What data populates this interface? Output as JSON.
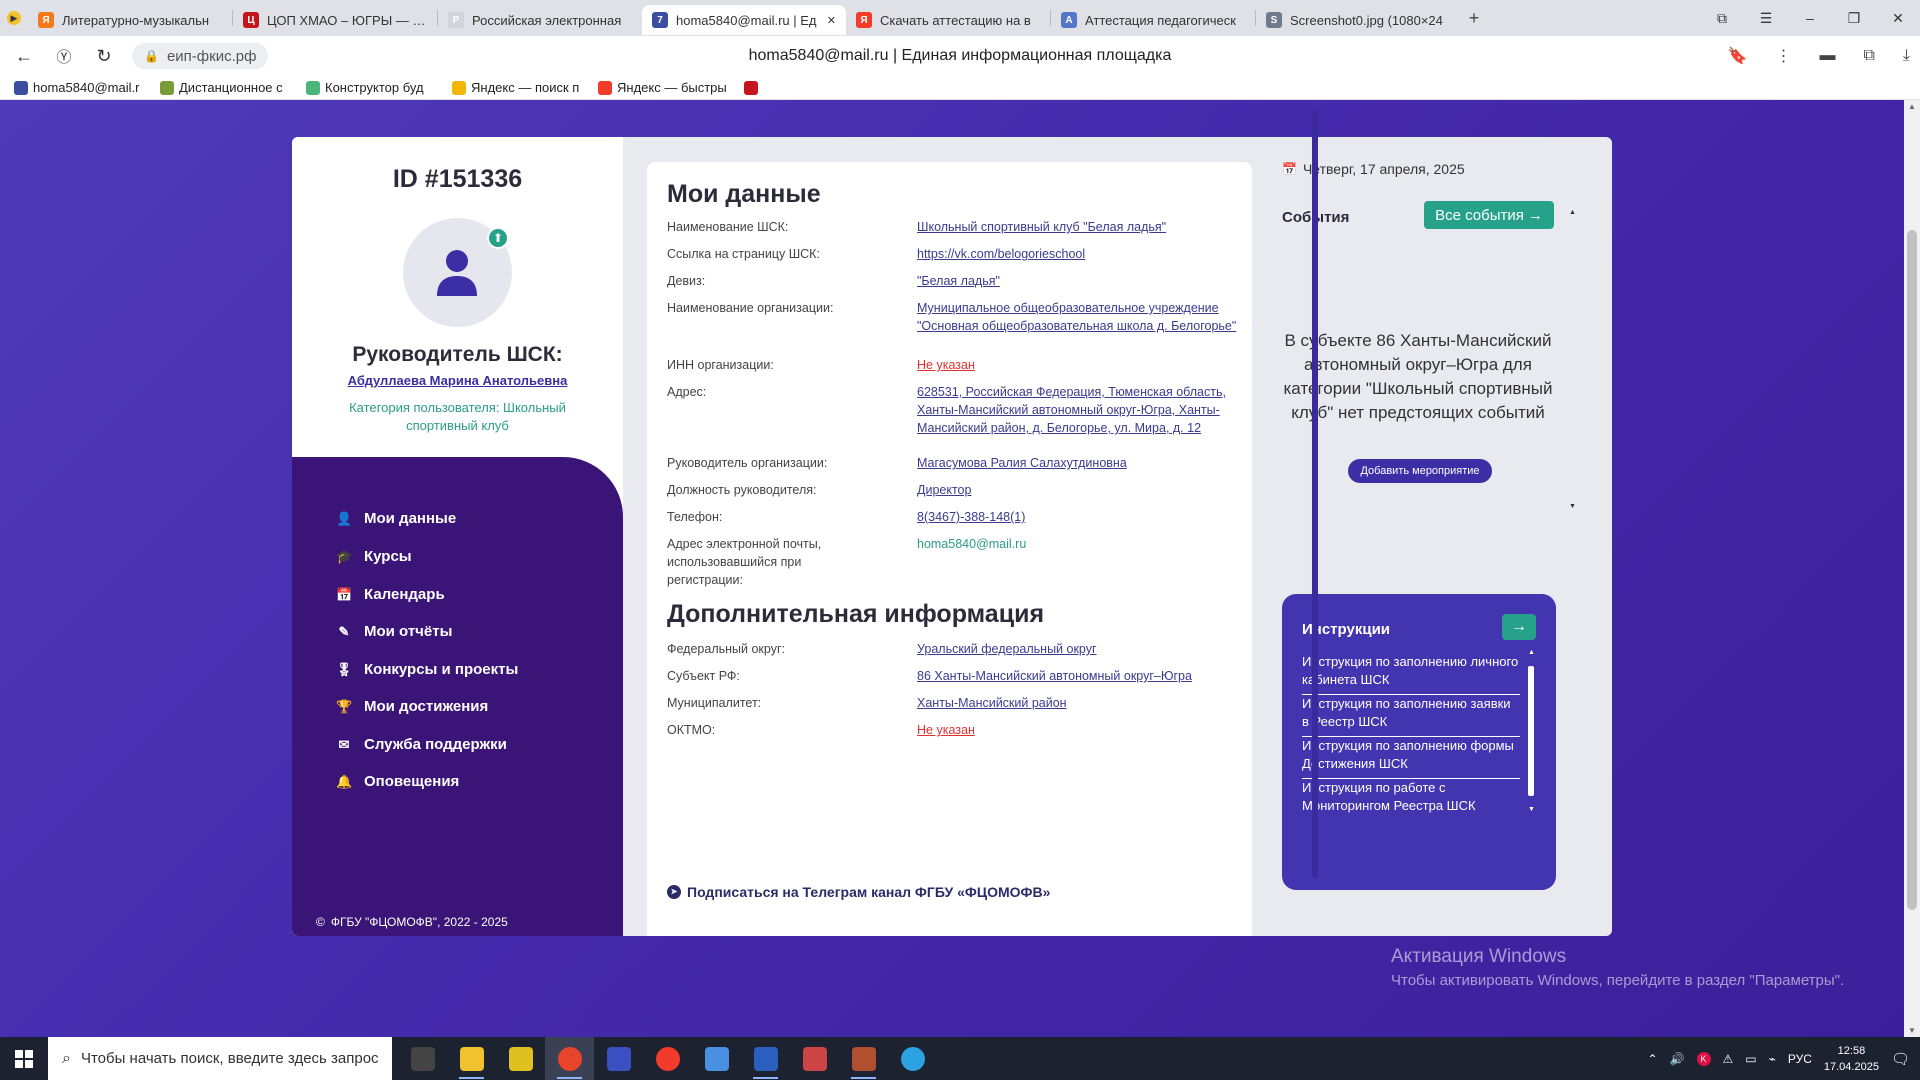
{
  "browser": {
    "tabs": [
      {
        "title": "Литературно-музыкальн",
        "favicon_color": "#f27a1a",
        "favicon_glyph": "Я"
      },
      {
        "title": "ЦОП ХМАО – ЮГРЫ — Эл",
        "favicon_color": "#c4161c",
        "favicon_glyph": "Ц"
      },
      {
        "title": "Российская электронная",
        "favicon_color": "#d0d4dc",
        "favicon_glyph": "Р"
      },
      {
        "title": "homa5840@mail.ru | Ед",
        "favicon_color": "#3b4fa0",
        "favicon_glyph": "7",
        "active": true
      },
      {
        "title": "Скачать аттестацию на в",
        "favicon_color": "#f23b2b",
        "favicon_glyph": "Я"
      },
      {
        "title": "Аттестация педагогическ",
        "favicon_color": "#5477c9",
        "favicon_glyph": "А"
      },
      {
        "title": "Screenshot0.jpg (1080×24",
        "favicon_color": "#6f7b8c",
        "favicon_glyph": "S"
      }
    ],
    "url": "еип-фкис.рф",
    "page_title": "homa5840@mail.ru | Единая информационная площадка",
    "bookmarks": [
      {
        "label": "homa5840@mail.r",
        "favicon_color": "#3b4fa0"
      },
      {
        "label": "Дистанционное с",
        "favicon_color": "#7a9a3a"
      },
      {
        "label": "Конструктор буд",
        "favicon_color": "#4bb57a"
      },
      {
        "label": "Яндекс — поиск п",
        "favicon_color": "#f2b705"
      },
      {
        "label": "Яндекс — быстры",
        "favicon_color": "#f23b2b"
      },
      {
        "label": "",
        "favicon_color": "#c4161c"
      }
    ]
  },
  "profile": {
    "id_title": "ID #151336",
    "role": "Руководитель ШСК:",
    "name": "Абдуллаева Марина Анатольевна",
    "category": "Категория пользователя: Школьный спортивный клуб"
  },
  "nav": [
    {
      "label": "Мои данные",
      "icon": "user-icon",
      "glyph": "👤"
    },
    {
      "label": "Курсы",
      "icon": "graduation-cap-icon",
      "glyph": "🎓"
    },
    {
      "label": "Календарь",
      "icon": "calendar-icon",
      "glyph": "📅"
    },
    {
      "label": "Мои отчёты",
      "icon": "edit-icon",
      "glyph": "✎"
    },
    {
      "label": "Конкурсы и проекты",
      "icon": "medal-icon",
      "glyph": "🎖"
    },
    {
      "label": "Мои достижения",
      "icon": "trophy-icon",
      "glyph": "🏆"
    },
    {
      "label": "Служба поддержки",
      "icon": "envelope-icon",
      "glyph": "✉"
    },
    {
      "label": "Оповещения",
      "icon": "bell-icon",
      "glyph": "🔔"
    }
  ],
  "copyright": "ФГБУ \"ФЦОМОФВ\", 2022 - 2025",
  "my_data": {
    "title": "Мои данные",
    "rows": [
      {
        "label": "Наименование ШСК:",
        "value": "Школьный спортивный клуб \"Белая ладья\"",
        "style": "link"
      },
      {
        "label": "Ссылка на страницу ШСК:",
        "value": "https://vk.com/belogorieschool",
        "style": "link"
      },
      {
        "label": "Девиз:",
        "value": "\"Белая ладья\"",
        "style": "link"
      },
      {
        "label": "Наименование организации:",
        "value": "Муниципальное общеобразовательное учреждение \"Основная общеобразовательная школа д. Белогорье\"",
        "style": "link"
      },
      {
        "label": "ИНН организации:",
        "value": "Не указан",
        "style": "red"
      },
      {
        "label": "Адрес:",
        "value": "628531, Российская Федерация, Тюменская область, Ханты-Мансийский автономный округ-Югра, Ханты-Мансийский район, д. Белогорье, ул. Мира, д. 12",
        "style": "link"
      },
      {
        "label": "Руководитель организации:",
        "value": "Магасумова Ралия Салахутдиновна",
        "style": "link"
      },
      {
        "label": "Должность руководителя:",
        "value": "Директор",
        "style": "link"
      },
      {
        "label": "Телефон:",
        "value": "8(3467)-388-148(1)",
        "style": "link"
      },
      {
        "label": "Адрес электронной почты, использовавшийся при регистрации:",
        "value": "homa5840@mail.ru",
        "style": "green"
      }
    ]
  },
  "extra_info": {
    "title": "Дополнительная информация",
    "rows": [
      {
        "label": "Федеральный округ:",
        "value": "Уральский федеральный округ",
        "style": "link"
      },
      {
        "label": "Субъект РФ:",
        "value": "86 Ханты-Мансийский автономный округ–Югра",
        "style": "link"
      },
      {
        "label": "Муниципалитет:",
        "value": "Ханты-Мансийский район",
        "style": "link"
      },
      {
        "label": "ОКТМО:",
        "value": "Не указан",
        "style": "red"
      }
    ]
  },
  "telegram_link": "Подписаться на Телеграм канал ФГБУ «ФЦОМОФВ»",
  "events": {
    "date": "Четверг, 17 апреля, 2025",
    "title": "События",
    "all_button": "Все события",
    "empty_text": "В субъекте 86 Ханты-Мансийский автономный округ–Югра для категории \"Школьный спортивный клуб\" нет предстоящих событий",
    "add_button": "Добавить мероприятие"
  },
  "instructions": {
    "title": "Инструкции",
    "items": [
      "Инструкция по заполнению личного кабинета ШСК",
      "Инструкция по заполнению заявки в Реестр ШСК",
      "Инструкция по заполнению формы Достижения ШСК",
      "Инструкция по работе с Мониторингом Реестра ШСК"
    ]
  },
  "watermark": {
    "line1": "Активация Windows",
    "line2": "Чтобы активировать Windows, перейдите в раздел \"Параметры\"."
  },
  "taskbar": {
    "search_placeholder": "Чтобы начать поиск, введите здесь запрос",
    "apps": [
      {
        "name": "app-icon",
        "color": "#444"
      },
      {
        "name": "explorer-icon",
        "color": "#f2c12e"
      },
      {
        "name": "app-icon-2",
        "color": "#e0c020"
      },
      {
        "name": "yandex-browser-icon",
        "color": "#e8432b"
      },
      {
        "name": "app-icon-3",
        "color": "#3a50c0"
      },
      {
        "name": "yandex-icon",
        "color": "#f23b2b"
      },
      {
        "name": "app-icon-4",
        "color": "#4a90e2"
      },
      {
        "name": "word-icon",
        "color": "#2b5fbf"
      },
      {
        "name": "app-icon-5",
        "color": "#c44"
      },
      {
        "name": "app-icon-6",
        "color": "#b05030"
      },
      {
        "name": "telegram-icon",
        "color": "#2aa3e0"
      }
    ],
    "lang": "РУС",
    "time": "12:58",
    "date": "17.04.2025"
  }
}
